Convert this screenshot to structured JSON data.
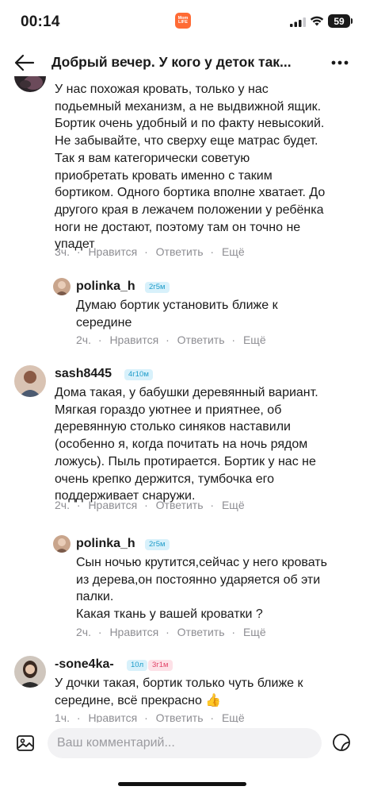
{
  "status_bar": {
    "time": "00:14",
    "app_badge_line1": "Mom",
    "app_badge_line2": "LIFE",
    "battery": "59"
  },
  "header": {
    "title": "Добрый вечер. У кого у деток так..."
  },
  "comments": [
    {
      "lines": [
        "У нас похожая кровать, только у нас",
        "подьемный механизм, а не выдвижной ящик.",
        "Бортик очень удобный и по факту невысокий.",
        "Не забывайте, что сверху еще матрас будет.",
        "Так я вам категорически советую",
        "приобретать кровать именно с таким",
        "бортиком. Одного бортика вполне хватает. До",
        "другого края в лежачем положении у ребёнка",
        "ноги не достают, поэтому там он точно не",
        "упадет"
      ],
      "time": "3ч.",
      "like": "Нравится",
      "reply": "Ответить",
      "more": "Ещё"
    },
    {
      "username": "polinka_h",
      "badge": "2г5м",
      "lines": [
        "Думаю бортик установить ближе к",
        "середине"
      ],
      "time": "2ч.",
      "like": "Нравится",
      "reply": "Ответить",
      "more": "Ещё"
    },
    {
      "username": "sash8445",
      "badge": "4г10м",
      "lines": [
        "Дома такая, у бабушки деревянный вариант.",
        "Мягкая гораздо уютнее и приятнее, об",
        "деревянную столько синяков наставили",
        "(особенно я, когда почитать на ночь рядом",
        "ложусь). Пыль протирается. Бортик у нас не",
        "очень крепко держится, тумбочка его",
        "поддерживает снаружи."
      ],
      "time": "2ч.",
      "like": "Нравится",
      "reply": "Ответить",
      "more": "Ещё"
    },
    {
      "username": "polinka_h",
      "badge": "2г5м",
      "lines": [
        "Сын ночью крутится,сейчас у него кровать",
        "из дерева,он постоянно ударяется об эти",
        "палки.",
        "Какая ткань у вашей кроватки ?"
      ],
      "time": "2ч.",
      "like": "Нравится",
      "reply": "Ответить",
      "more": "Ещё"
    },
    {
      "username": "-sone4ka-",
      "badge": "10л",
      "badge2": "3г1м",
      "lines": [
        "У дочки такая, бортик только чуть ближе к",
        "серединe, всё прекрасно 👍"
      ],
      "time": "1ч.",
      "like": "Нравится",
      "reply": "Ответить",
      "more": "Ещё"
    }
  ],
  "input": {
    "placeholder": "Ваш комментарий..."
  },
  "icons": {
    "back": "arrow-left-icon",
    "more": "more-dots-icon",
    "image": "image-icon",
    "sticker": "sticker-icon"
  },
  "colors": {
    "accent_blue_badge": "#1f9cc9",
    "accent_pink_badge": "#e2466a",
    "meta_gray": "#8e8e93"
  }
}
